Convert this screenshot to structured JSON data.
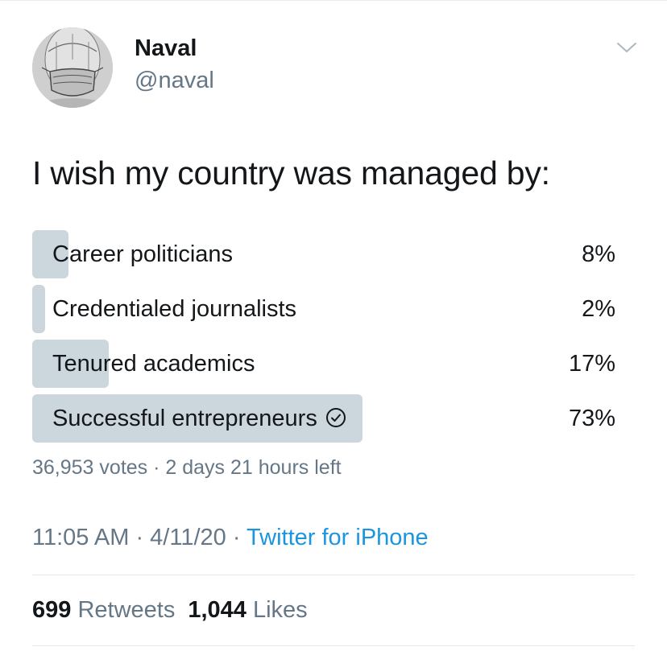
{
  "user": {
    "name": "Naval",
    "handle": "@naval"
  },
  "tweet": {
    "text": "I wish my country was managed by:"
  },
  "poll": {
    "options": [
      {
        "label": "Career politicians",
        "percent": "8%",
        "value": 8
      },
      {
        "label": "Credentialed journalists",
        "percent": "2%",
        "value": 2
      },
      {
        "label": "Tenured academics",
        "percent": "17%",
        "value": 17
      },
      {
        "label": "Successful entrepreneurs",
        "percent": "73%",
        "value": 73,
        "selected": true
      }
    ],
    "votes": "36,953 votes",
    "separator": " · ",
    "time_left": "2 days 21 hours left"
  },
  "meta": {
    "time": "11:05 AM",
    "date": "4/11/20",
    "separator": " · ",
    "source": "Twitter for iPhone"
  },
  "stats": {
    "retweets_count": "699",
    "retweets_label": "Retweets",
    "likes_count": "1,044",
    "likes_label": "Likes"
  },
  "icons": {
    "menu": "chevron-down-icon",
    "selected": "check-circle-icon"
  },
  "colors": {
    "text": "#14171a",
    "secondary": "#657786",
    "link": "#1b95e0",
    "poll_bar": "#ccd6dd"
  }
}
